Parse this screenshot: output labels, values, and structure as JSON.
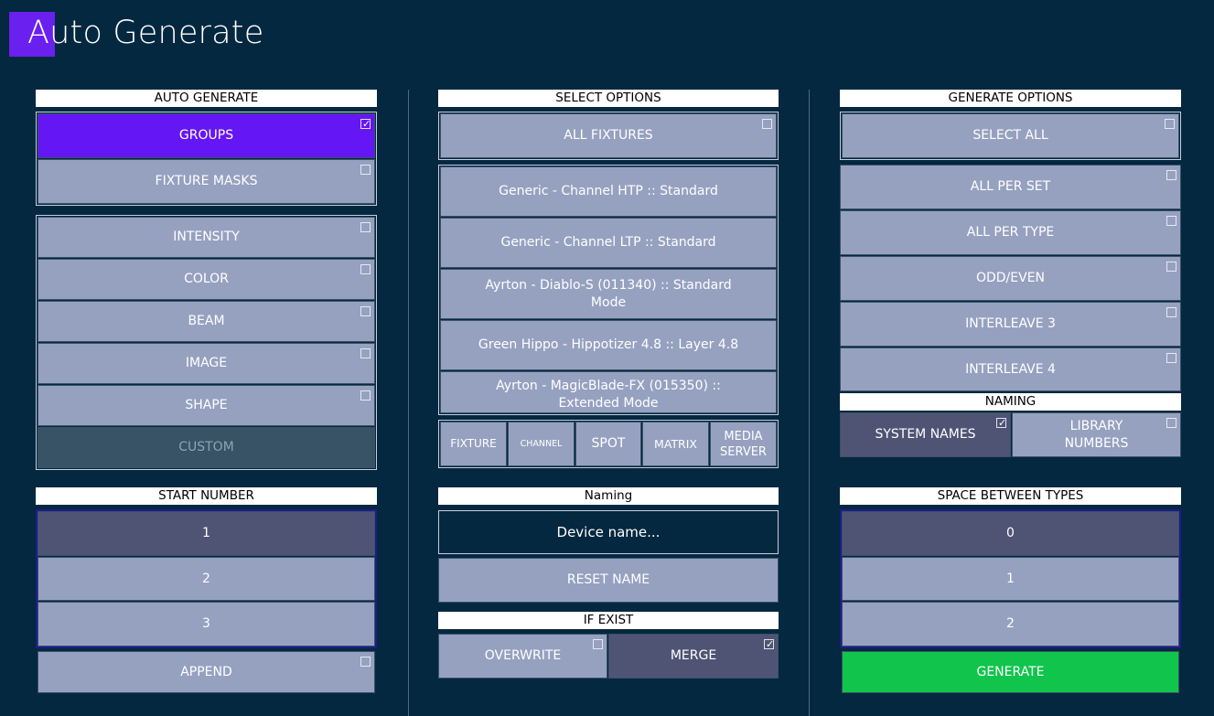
{
  "app": {
    "title": "Auto Generate"
  },
  "auto_generate": {
    "header": "AUTO GENERATE",
    "modes": [
      {
        "label": "GROUPS",
        "checked": true,
        "active": true
      },
      {
        "label": "FIXTURE MASKS",
        "checked": false,
        "active": false
      }
    ],
    "attributes": [
      {
        "label": "INTENSITY"
      },
      {
        "label": "COLOR"
      },
      {
        "label": "BEAM"
      },
      {
        "label": "IMAGE"
      },
      {
        "label": "SHAPE"
      },
      {
        "label": "CUSTOM",
        "disabled": true
      }
    ]
  },
  "start_number": {
    "header": "START NUMBER",
    "options": [
      "1",
      "2",
      "3"
    ],
    "selected": "1",
    "append_label": "APPEND"
  },
  "select_options": {
    "header": "SELECT OPTIONS",
    "all_fixtures": "ALL FIXTURES",
    "fixtures": [
      "Generic - Channel HTP :: Standard",
      "Generic - Channel LTP :: Standard",
      "Ayrton - Diablo-S (011340) :: Standard Mode",
      "Green Hippo - Hippotizer 4.8 :: Layer 4.8",
      "Ayrton - MagicBlade-FX (015350) :: Extended Mode"
    ],
    "filters": [
      "FIXTURE",
      "CHANNEL",
      "SPOT",
      "MATRIX",
      "MEDIA SERVER"
    ]
  },
  "naming_panel": {
    "header": "Naming",
    "input_value": "Device name...",
    "reset_label": "RESET NAME"
  },
  "if_exist": {
    "header": "IF EXIST",
    "options": [
      {
        "label": "OVERWRITE",
        "checked": false
      },
      {
        "label": "MERGE",
        "checked": true
      }
    ]
  },
  "generate_options": {
    "header": "GENERATE OPTIONS",
    "select_all": "SELECT ALL",
    "options": [
      "ALL PER SET",
      "ALL PER TYPE",
      "ODD/EVEN",
      "INTERLEAVE 3",
      "INTERLEAVE 4"
    ]
  },
  "naming_options": {
    "header": "NAMING",
    "options": [
      {
        "label": "SYSTEM NAMES",
        "checked": true
      },
      {
        "label": "LIBRARY NUMBERS",
        "checked": false
      }
    ]
  },
  "space_between_types": {
    "header": "SPACE BETWEEN TYPES",
    "options": [
      "0",
      "1",
      "2"
    ],
    "selected": "0"
  },
  "generate_button": {
    "label": "GENERATE",
    "color": "#10c44c"
  },
  "colors": {
    "background": "#04283f",
    "accent": "#6516f4",
    "button": "#96a1c0",
    "selected": "#4f5474"
  }
}
